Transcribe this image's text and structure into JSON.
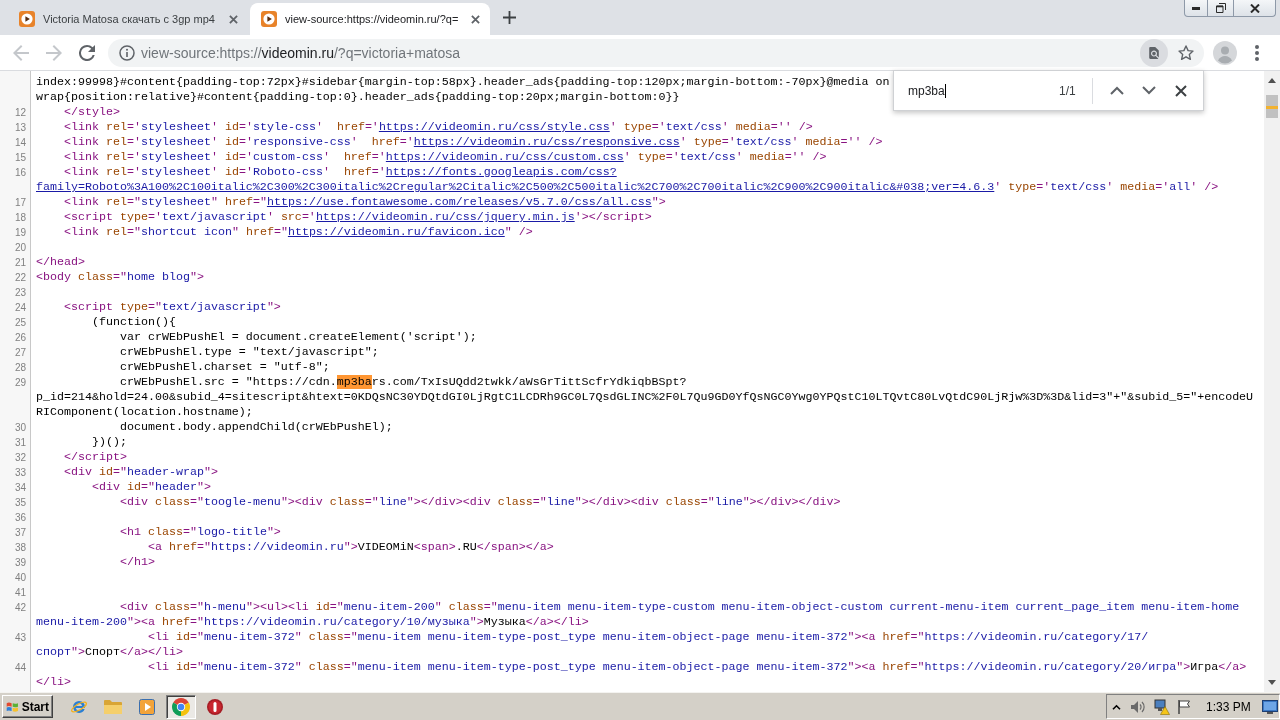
{
  "tabs": [
    {
      "title": "Victoria Matosa скачать с 3gp mp4",
      "selected": false
    },
    {
      "title": "view-source:https://videomin.ru/?q=",
      "selected": true
    }
  ],
  "toolbar": {
    "nav_buttons": [
      {
        "kind": "back",
        "disabled": true
      },
      {
        "kind": "forward",
        "disabled": true
      },
      {
        "kind": "reload",
        "disabled": false
      }
    ],
    "address": {
      "scheme": "view-source:https://",
      "host": "videomin.ru",
      "path": "/?q=victoria+matosa"
    }
  },
  "find_bar": {
    "query": "mp3ba",
    "count": "1/1"
  },
  "source": {
    "lines": [
      {
        "segments": [
          {
            "kind": "code",
            "text": "index:99998}#content{padding-top:72px}#sidebar{margin-top:58px}.header_ads{padding-top:120px;margin-bottom:-70px}@media on"
          },
          {
            "kind": "break"
          },
          {
            "kind": "code",
            "text": "wrap{position:relative}#content{padding-top:0}.header_ads{padding-top:20px;margin-bottom:0}}"
          }
        ]
      },
      {
        "number": "12",
        "segments": [
          {
            "kind": "code",
            "text": "    </style>"
          }
        ]
      },
      {
        "number": "13",
        "segments": [
          {
            "kind": "code",
            "text": "    <link rel='stylesheet' id='style-css'  href='"
          },
          {
            "kind": "link",
            "text": "https://videomin.ru/css/style.css"
          },
          {
            "kind": "code",
            "text": "' type='text/css' media='' />"
          }
        ]
      },
      {
        "number": "14",
        "segments": [
          {
            "kind": "code",
            "text": "    <link rel='stylesheet' id='responsive-css'  href='"
          },
          {
            "kind": "link",
            "text": "https://videomin.ru/css/responsive.css"
          },
          {
            "kind": "code",
            "text": "' type='text/css' media='' />"
          }
        ]
      },
      {
        "number": "15",
        "segments": [
          {
            "kind": "code",
            "text": "    <link rel='stylesheet' id='custom-css'  href='"
          },
          {
            "kind": "link",
            "text": "https://videomin.ru/css/custom.css"
          },
          {
            "kind": "code",
            "text": "' type='text/css' media='' />"
          }
        ]
      },
      {
        "number": "16",
        "segments": [
          {
            "kind": "code",
            "text": "    <link rel='stylesheet' id='Roboto-css'  href='"
          },
          {
            "kind": "link",
            "text": "https://fonts.googleapis.com/css?"
          },
          {
            "kind": "break"
          },
          {
            "kind": "link",
            "text": "family=Roboto%3A100%2C100italic%2C300%2C300italic%2Cregular%2Citalic%2C500%2C500italic%2C700%2C700italic%2C900%2C900italic&#038;ver=4.6.3"
          },
          {
            "kind": "code",
            "text": "' type='text/css' media='all' />"
          }
        ]
      },
      {
        "number": "17",
        "segments": [
          {
            "kind": "code",
            "text": "    <link rel=\"stylesheet\" href=\""
          },
          {
            "kind": "link",
            "text": "https://use.fontawesome.com/releases/v5.7.0/css/all.css"
          },
          {
            "kind": "code",
            "text": "\">"
          }
        ]
      },
      {
        "number": "18",
        "segments": [
          {
            "kind": "code",
            "text": "    <script type='text/javascript' src='"
          },
          {
            "kind": "link",
            "text": "https://videomin.ru/css/jquery.min.js"
          },
          {
            "kind": "code",
            "text": "'></script>"
          }
        ]
      },
      {
        "number": "19",
        "segments": [
          {
            "kind": "code",
            "text": "    <link rel=\"shortcut icon\" href=\""
          },
          {
            "kind": "link",
            "text": "https://videomin.ru/favicon.ico"
          },
          {
            "kind": "code",
            "text": "\" />"
          }
        ]
      },
      {
        "number": "20"
      },
      {
        "number": "21",
        "segments": [
          {
            "kind": "code",
            "text": "</head>"
          }
        ]
      },
      {
        "number": "22",
        "segments": [
          {
            "kind": "code",
            "text": "<body class=\"home blog\">"
          }
        ]
      },
      {
        "number": "23"
      },
      {
        "number": "24",
        "segments": [
          {
            "kind": "code",
            "text": "    <script type=\"text/javascript\">"
          }
        ]
      },
      {
        "number": "25",
        "segments": [
          {
            "kind": "code",
            "text": "        (function(){"
          }
        ]
      },
      {
        "number": "26",
        "segments": [
          {
            "kind": "code",
            "text": "            var crWEbPushEl = document.createElement('script');"
          }
        ]
      },
      {
        "number": "27",
        "segments": [
          {
            "kind": "code",
            "text": "            crWEbPushEl.type = \"text/javascript\";"
          }
        ]
      },
      {
        "number": "28",
        "segments": [
          {
            "kind": "code",
            "text": "            crWEbPushEl.charset = \"utf-8\";"
          }
        ]
      },
      {
        "number": "29",
        "segments": [
          {
            "kind": "code",
            "text": "            crWEbPushEl.src = \"https://cdn."
          },
          {
            "kind": "match",
            "text": "mp3ba"
          },
          {
            "kind": "code",
            "text": "rs.com/TxIsUQdd2twkk/aWsGrTittScfrYdkiqbBSpt?"
          },
          {
            "kind": "break"
          },
          {
            "kind": "code",
            "text": "p_id=214&hold=24.00&subid_4=sitescript&htext=0KDQsNC30YDQtdGI0LjRgtC1LCDRh9GC0L7QsdGLINC%2F0L7Qu9GD0YfQsNGC0Ywg0YPQstC10LTQvtC80LvQtdC90LjRjw%3D%3D&lid=3\"+\"&subid_5=\"+encodeU"
          },
          {
            "kind": "break"
          },
          {
            "kind": "code",
            "text": "RIComponent(location.hostname);"
          }
        ]
      },
      {
        "number": "30",
        "segments": [
          {
            "kind": "code",
            "text": "            document.body.appendChild(crWEbPushEl);"
          }
        ]
      },
      {
        "number": "31",
        "segments": [
          {
            "kind": "code",
            "text": "        })();"
          }
        ]
      },
      {
        "number": "32",
        "segments": [
          {
            "kind": "code",
            "text": "    </script>"
          }
        ]
      },
      {
        "number": "33",
        "segments": [
          {
            "kind": "code",
            "text": "    <div id=\"header-wrap\">"
          }
        ]
      },
      {
        "number": "34",
        "segments": [
          {
            "kind": "code",
            "text": "        <div id=\"header\">"
          }
        ]
      },
      {
        "number": "35",
        "segments": [
          {
            "kind": "code",
            "text": "            <div class=\"toogle-menu\"><div class=\"line\"></div><div class=\"line\"></div><div class=\"line\"></div></div>"
          }
        ]
      },
      {
        "number": "36"
      },
      {
        "number": "37",
        "segments": [
          {
            "kind": "code",
            "text": "            <h1 class=\"logo-title\">"
          }
        ]
      },
      {
        "number": "38",
        "segments": [
          {
            "kind": "code",
            "text": "                <a href=\"https://videomin.ru\">VIDEOMiN<span>.RU</span></a>"
          }
        ]
      },
      {
        "number": "39",
        "segments": [
          {
            "kind": "code",
            "text": "            </h1>"
          }
        ]
      },
      {
        "number": "40"
      },
      {
        "number": "41"
      },
      {
        "number": "42",
        "segments": [
          {
            "kind": "code",
            "text": "            <div class=\"h-menu\"><ul><li id=\"menu-item-200\" class=\"menu-item menu-item-type-custom menu-item-object-custom current-menu-item current_page_item menu-item-home"
          },
          {
            "kind": "break"
          },
          {
            "kind": "code",
            "text": "menu-item-200\"><a href=\"https://videomin.ru/category/10/музыка\">Музыка</a></li>"
          }
        ]
      },
      {
        "number": "43",
        "segments": [
          {
            "kind": "code",
            "text": "                <li id=\"menu-item-372\" class=\"menu-item menu-item-type-post_type menu-item-object-page menu-item-372\"><a href=\"https://videomin.ru/category/17/"
          },
          {
            "kind": "break"
          },
          {
            "kind": "code",
            "text": "спорт\">Спорт</a></li>"
          }
        ]
      },
      {
        "number": "44",
        "segments": [
          {
            "kind": "code",
            "text": "                <li id=\"menu-item-372\" class=\"menu-item menu-item-type-post_type menu-item-object-page menu-item-372\"><a href=\"https://videomin.ru/category/20/игра\">Игра</a>"
          },
          {
            "kind": "break"
          },
          {
            "kind": "code",
            "text": "</li>"
          }
        ]
      }
    ]
  },
  "taskbar": {
    "start": "Start",
    "items": [
      {
        "selected": false
      },
      {
        "selected": false
      },
      {
        "selected": false
      },
      {
        "selected": true
      },
      {
        "selected": false
      }
    ],
    "clock": "1:33 PM"
  }
}
